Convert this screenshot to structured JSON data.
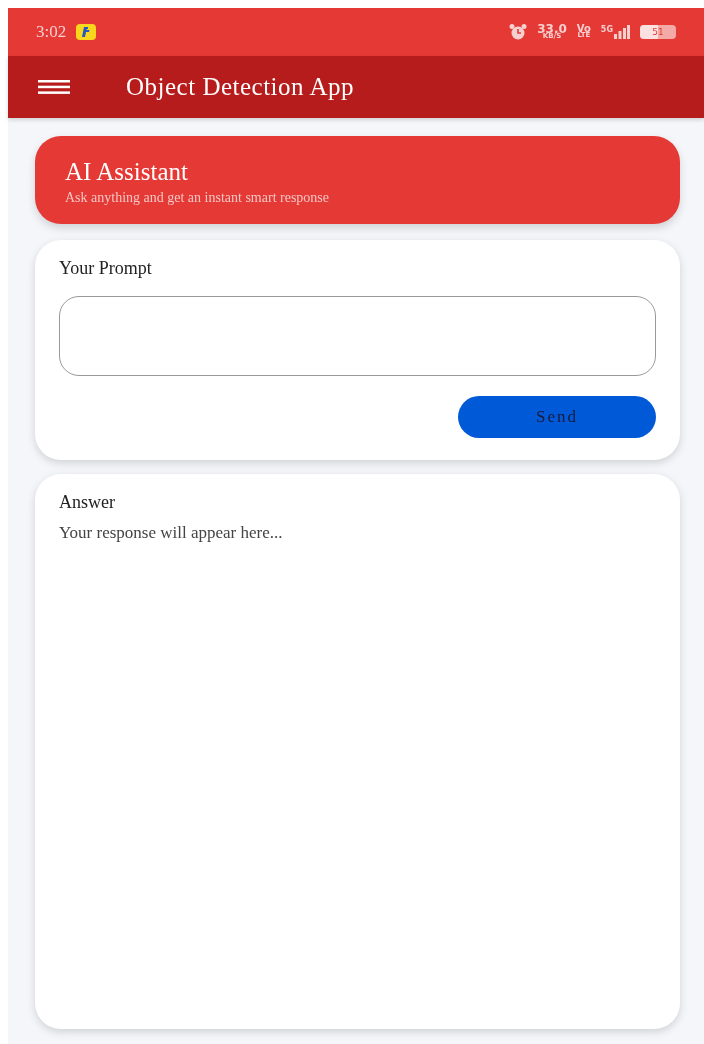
{
  "status_bar": {
    "time": "3:02",
    "speed": "33.0",
    "speed_unit": "KB/S",
    "volte_top": "Vo",
    "volte_bottom": "LTE",
    "network": "5G",
    "battery": "51"
  },
  "app_bar": {
    "title": "Object Detection App"
  },
  "header": {
    "title": "AI Assistant",
    "subtitle": "Ask anything and get an instant smart response"
  },
  "prompt": {
    "label": "Your Prompt",
    "button": "Send"
  },
  "answer": {
    "label": "Answer",
    "text": "Your response will appear here..."
  }
}
